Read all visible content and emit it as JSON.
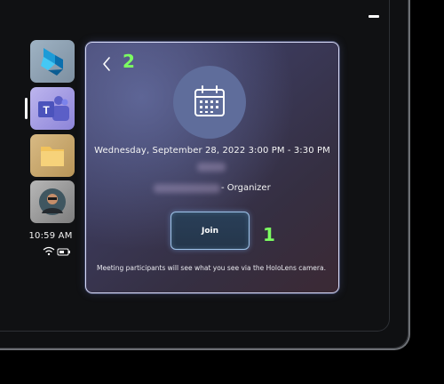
{
  "sidebar": {
    "apps": [
      {
        "name": "Dynamics 365 Guides",
        "icon": "dynamics-logo-icon"
      },
      {
        "name": "Microsoft Teams",
        "icon": "teams-logo-icon"
      },
      {
        "name": "Files",
        "icon": "folder-icon"
      },
      {
        "name": "Profile",
        "icon": "avatar-icon"
      }
    ],
    "clock": "10:59 AM",
    "status_icons": [
      "wifi-icon",
      "battery-icon"
    ]
  },
  "window": {
    "minimize_icon": "minimize-icon"
  },
  "meeting_card": {
    "back_icon": "chevron-left-icon",
    "calendar_icon": "calendar-icon",
    "date_time": "Wednesday, September 28, 2022 3:00 PM - 3:30 PM",
    "organizer_suffix": "- Organizer",
    "join_label": "Join",
    "disclaimer": "Meeting participants will see what you see via the HoloLens camera."
  },
  "annotations": {
    "label_1": "1",
    "label_2": "2"
  },
  "colors": {
    "annotation": "#7cff61",
    "card_border": "#d8dbf7",
    "calendar_circle": "#5f6d9b",
    "join_border": "#9fc4ea"
  }
}
